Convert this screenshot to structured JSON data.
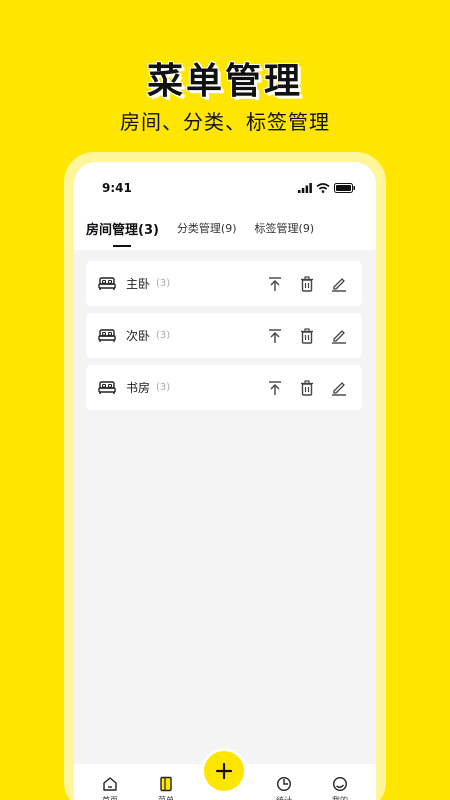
{
  "hero": {
    "title": "菜单管理",
    "subtitle": "房间、分类、标签管理"
  },
  "status_bar": {
    "time": "9:41"
  },
  "tabs": [
    {
      "label": "房间管理(3)",
      "active": true
    },
    {
      "label": "分类管理(9)",
      "active": false
    },
    {
      "label": "标签管理(9)",
      "active": false
    }
  ],
  "rooms": [
    {
      "name": "主卧",
      "count": "(3)",
      "icon": "bed-icon"
    },
    {
      "name": "次卧",
      "count": "(3)",
      "icon": "bed-icon"
    },
    {
      "name": "书房",
      "count": "(3)",
      "icon": "bed-icon"
    }
  ],
  "row_actions": [
    "move-to-top-icon",
    "trash-icon",
    "edit-icon"
  ],
  "bottom_nav": [
    {
      "label": "首页",
      "icon": "home-icon"
    },
    {
      "label": "菜单",
      "icon": "menu-book-icon"
    },
    {
      "label": "统计",
      "icon": "pie-chart-icon"
    },
    {
      "label": "我的",
      "icon": "profile-icon"
    }
  ],
  "fab": {
    "icon": "plus-icon"
  },
  "colors": {
    "brand_yellow": "#FFE600",
    "frame_yellow": "#FFF59A",
    "screen_bg": "#F4F4F4",
    "text_dark": "#111111",
    "text_muted": "#AAAAAA"
  }
}
